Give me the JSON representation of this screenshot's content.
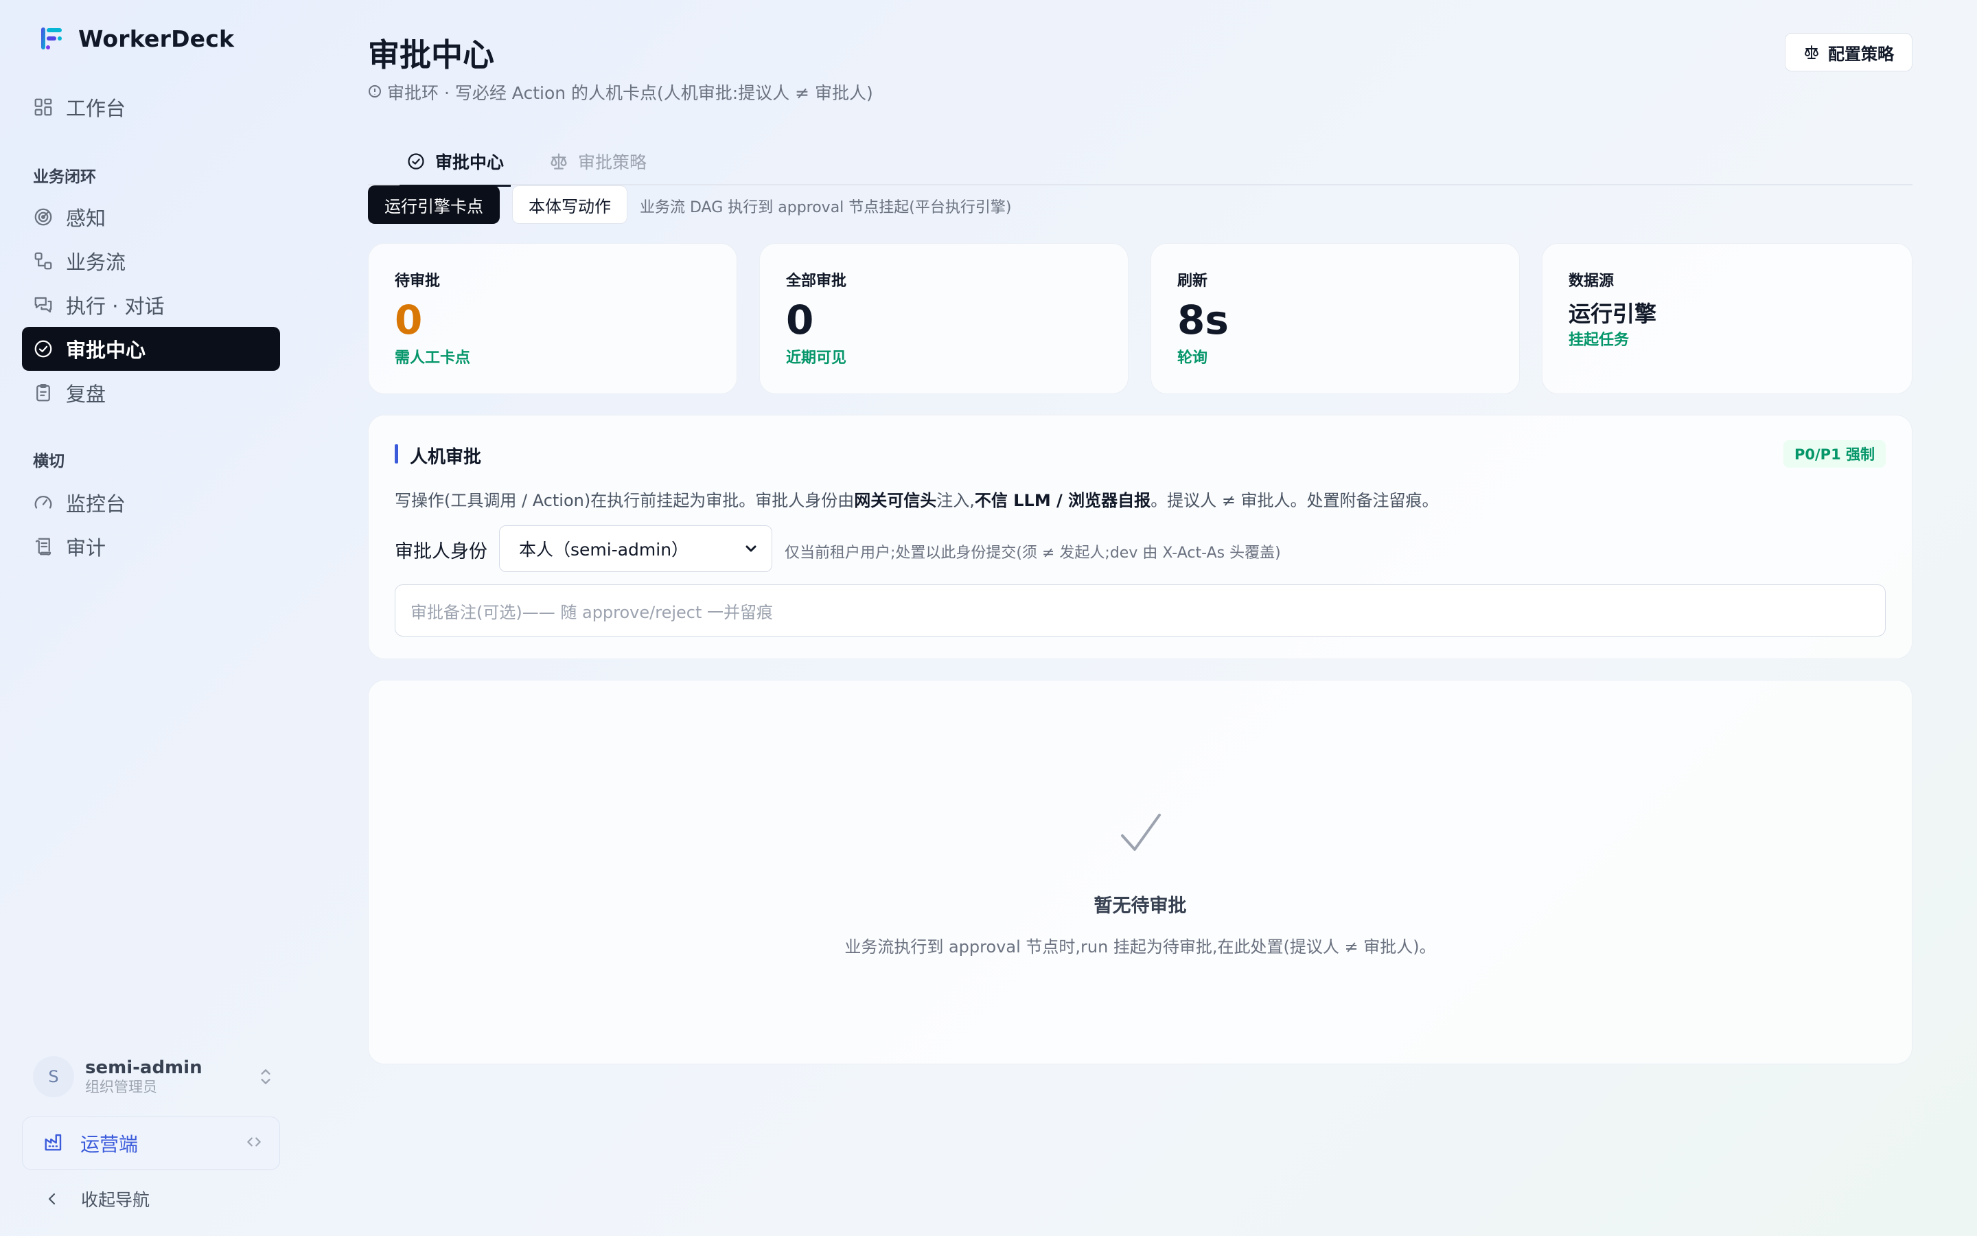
{
  "app": {
    "name": "WorkerDeck"
  },
  "sidebar": {
    "top_item": {
      "label": "工作台",
      "icon": "dashboard-icon"
    },
    "section_business": "业务闭环",
    "business_items": [
      {
        "label": "感知",
        "icon": "radar-icon"
      },
      {
        "label": "业务流",
        "icon": "workflow-icon"
      },
      {
        "label": "执行 · 对话",
        "icon": "chat-icon"
      },
      {
        "label": "审批中心",
        "icon": "check-circle-icon",
        "active": true
      },
      {
        "label": "复盘",
        "icon": "clipboard-icon"
      }
    ],
    "section_cross": "横切",
    "cross_items": [
      {
        "label": "监控台",
        "icon": "gauge-icon"
      },
      {
        "label": "审计",
        "icon": "scroll-icon"
      }
    ],
    "user": {
      "initial": "S",
      "name": "semi-admin",
      "role": "组织管理员"
    },
    "ops": {
      "label": "运营端"
    },
    "collapse_label": "收起导航"
  },
  "header": {
    "title": "审批中心",
    "subtitle": "审批环 · 写必经 Action 的人机卡点(人机审批:提议人 ≠ 审批人)",
    "config_button": "配置策略"
  },
  "tabs": [
    {
      "label": "审批中心",
      "active": true
    },
    {
      "label": "审批策略",
      "active": false
    }
  ],
  "mode": {
    "options": [
      "运行引擎卡点",
      "本体写动作"
    ],
    "selected": "运行引擎卡点",
    "description": "业务流 DAG 执行到 approval 节点挂起(平台执行引擎)"
  },
  "stats": [
    {
      "label": "待审批",
      "value": "0",
      "hint": "需人工卡点",
      "value_color": "#d97706"
    },
    {
      "label": "全部审批",
      "value": "0",
      "hint": "近期可见"
    },
    {
      "label": "刷新",
      "value": "8s",
      "hint": "轮询"
    },
    {
      "label": "数据源",
      "value": "运行引擎",
      "hint": "挂起任务"
    }
  ],
  "panel": {
    "title": "人机审批",
    "badge": "P0/P1 强制",
    "desc_part1": "写操作(工具调用 / Action)在执行前挂起为审批。审批人身份由",
    "desc_bold1": "网关可信头",
    "desc_part2": "注入,",
    "desc_bold2": "不信 LLM / 浏览器自报",
    "desc_part3": "。提议人 ≠ 审批人。处置附备注留痕。",
    "approver_label": "审批人身份",
    "approver_value": "本人（semi-admin）",
    "approver_hint": "仅当前租户用户;处置以此身份提交(须 ≠ 发起人;dev 由 X-Act-As 头覆盖)",
    "remark_placeholder": "审批备注(可选)—— 随 approve/reject 一并留痕"
  },
  "empty": {
    "title": "暂无待审批",
    "desc": "业务流执行到 approval 节点时,run 挂起为待审批,在此处置(提议人 ≠ 审批人)。"
  },
  "colors": {
    "accent": "#3b5bdb",
    "active_bg": "#0b0f19",
    "success": "#059669",
    "warning": "#d97706"
  }
}
